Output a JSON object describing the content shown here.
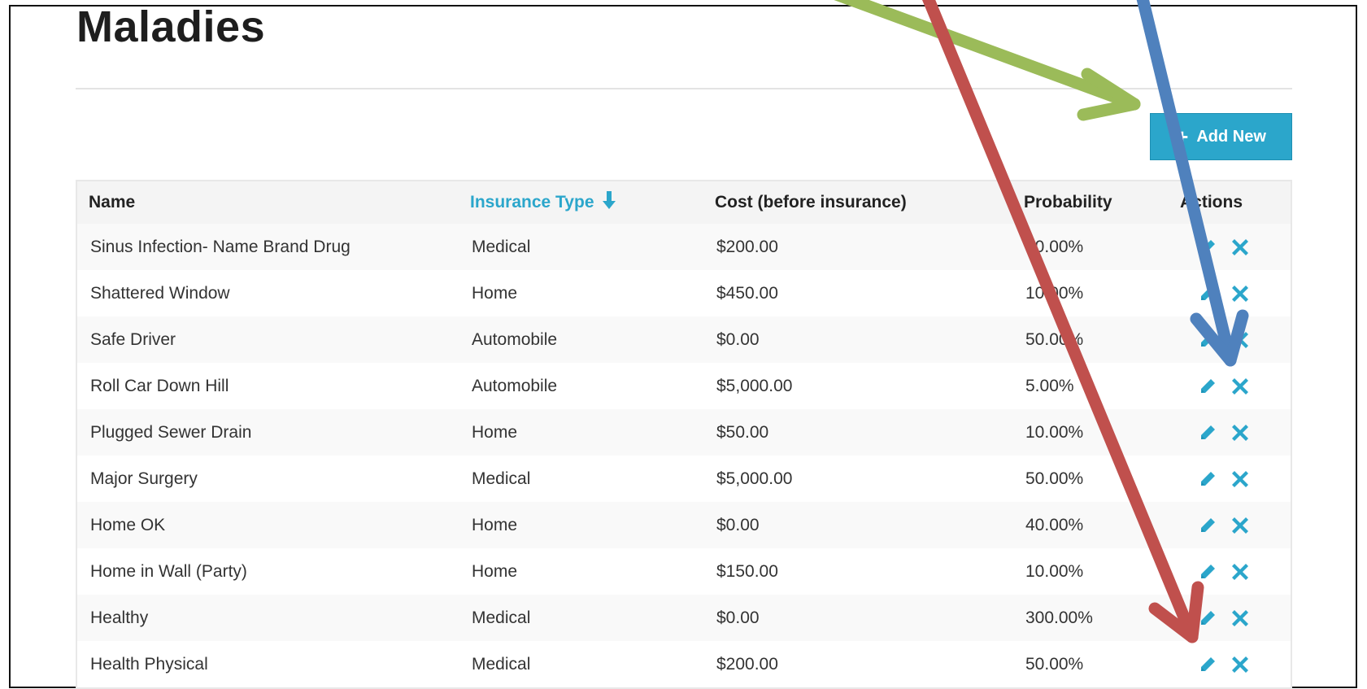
{
  "page": {
    "title": "Maladies"
  },
  "toolbar": {
    "add_label": "Add New",
    "add_icon": "plus-icon"
  },
  "table": {
    "columns": {
      "name": "Name",
      "insurance_type": "Insurance Type",
      "cost": "Cost (before insurance)",
      "probability": "Probability",
      "actions": "Actions"
    },
    "sort_icon": "arrow-down-icon",
    "rows": [
      {
        "name": "Sinus Infection- Name Brand Drug",
        "type": "Medical",
        "cost": "$200.00",
        "probability": "50.00%"
      },
      {
        "name": "Shattered Window",
        "type": "Home",
        "cost": "$450.00",
        "probability": "10.00%"
      },
      {
        "name": "Safe Driver",
        "type": "Automobile",
        "cost": "$0.00",
        "probability": "50.00%"
      },
      {
        "name": "Roll Car Down Hill",
        "type": "Automobile",
        "cost": "$5,000.00",
        "probability": "5.00%"
      },
      {
        "name": "Plugged Sewer Drain",
        "type": "Home",
        "cost": "$50.00",
        "probability": "10.00%"
      },
      {
        "name": "Major Surgery",
        "type": "Medical",
        "cost": "$5,000.00",
        "probability": "50.00%"
      },
      {
        "name": "Home OK",
        "type": "Home",
        "cost": "$0.00",
        "probability": "40.00%"
      },
      {
        "name": "Home in Wall (Party)",
        "type": "Home",
        "cost": "$150.00",
        "probability": "10.00%"
      },
      {
        "name": "Healthy",
        "type": "Medical",
        "cost": "$0.00",
        "probability": "300.00%"
      },
      {
        "name": "Health Physical",
        "type": "Medical",
        "cost": "$200.00",
        "probability": "50.00%"
      }
    ],
    "row_action_icons": [
      "pencil-icon",
      "close-icon"
    ]
  },
  "colors": {
    "accent": "#2ba6cb",
    "arrow_green": "#9bbb59",
    "arrow_blue": "#4f81bd",
    "arrow_red": "#c0504d"
  }
}
